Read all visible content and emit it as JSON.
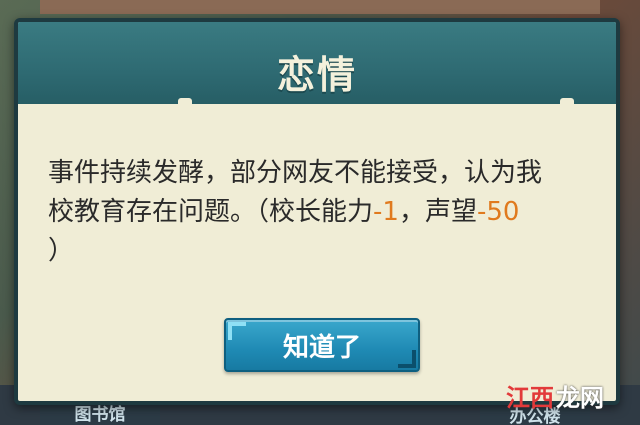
{
  "background": {
    "left_sign": "图书馆",
    "right_sign": "办公楼"
  },
  "dialog": {
    "title": "恋情",
    "message_line1": "事件持续发酵，部分网友不能接受，认为我",
    "message_line2_prefix": "校教育存在问题。（校长能力",
    "principal_ability_delta": "-1",
    "message_sep": "，声望",
    "reputation_delta": "-50",
    "message_line3": "）",
    "ok_label": "知道了"
  },
  "watermark": {
    "part1": "江西",
    "part2": "龙网"
  },
  "colors": {
    "header": "#2e6a72",
    "panel": "#f0edd6",
    "negative_value": "#e07a1e",
    "button": "#1f8ab4"
  }
}
